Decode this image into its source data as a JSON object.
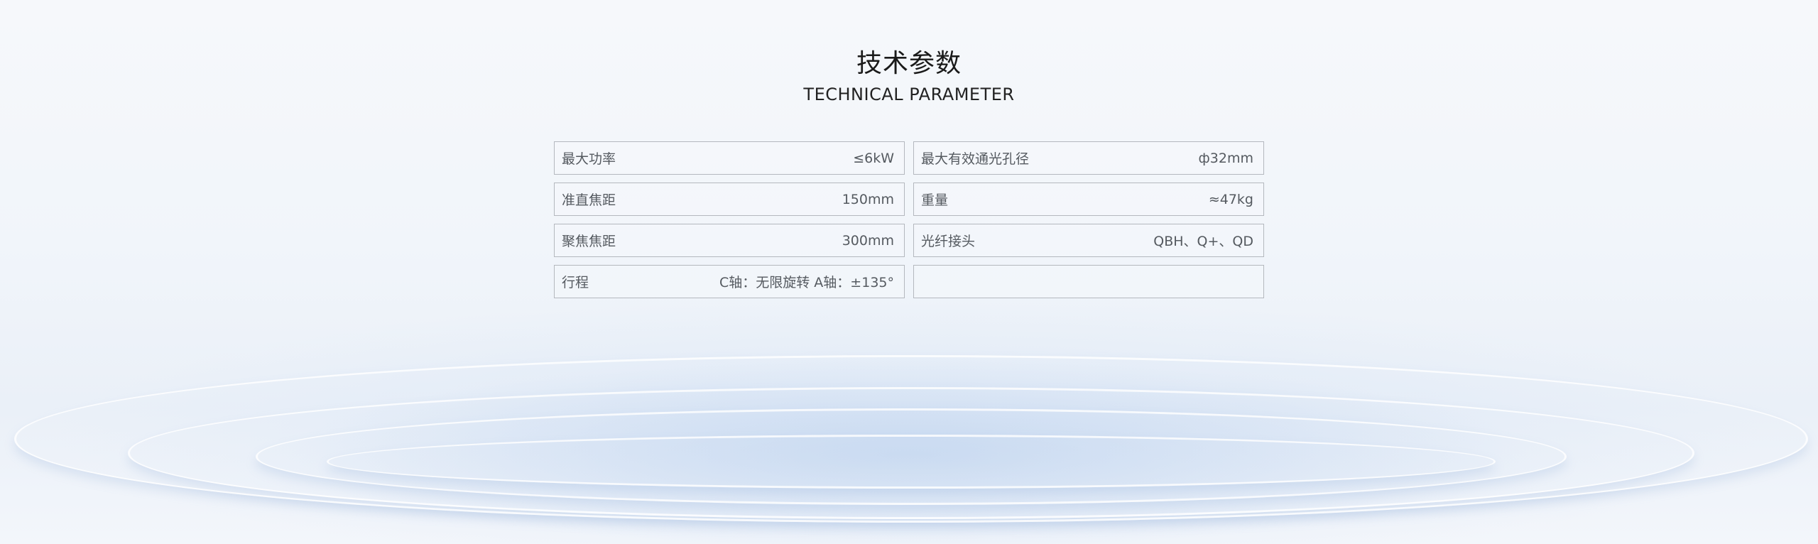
{
  "header": {
    "title_cn": "技术参数",
    "title_en": "TECHNICAL PARAMETER"
  },
  "params": [
    {
      "label": "最大功率",
      "value": "≤6kW"
    },
    {
      "label": "最大有效通光孔径",
      "value": "ф32mm"
    },
    {
      "label": "准直焦距",
      "value": "150mm"
    },
    {
      "label": "重量",
      "value": "≈47kg"
    },
    {
      "label": "聚焦焦距",
      "value": "300mm"
    },
    {
      "label": "光纤接头",
      "value": "QBH、Q+、QD"
    },
    {
      "label": "行程",
      "value": "C轴：无限旋转 A轴：±135°"
    },
    {
      "label": "",
      "value": ""
    }
  ]
}
